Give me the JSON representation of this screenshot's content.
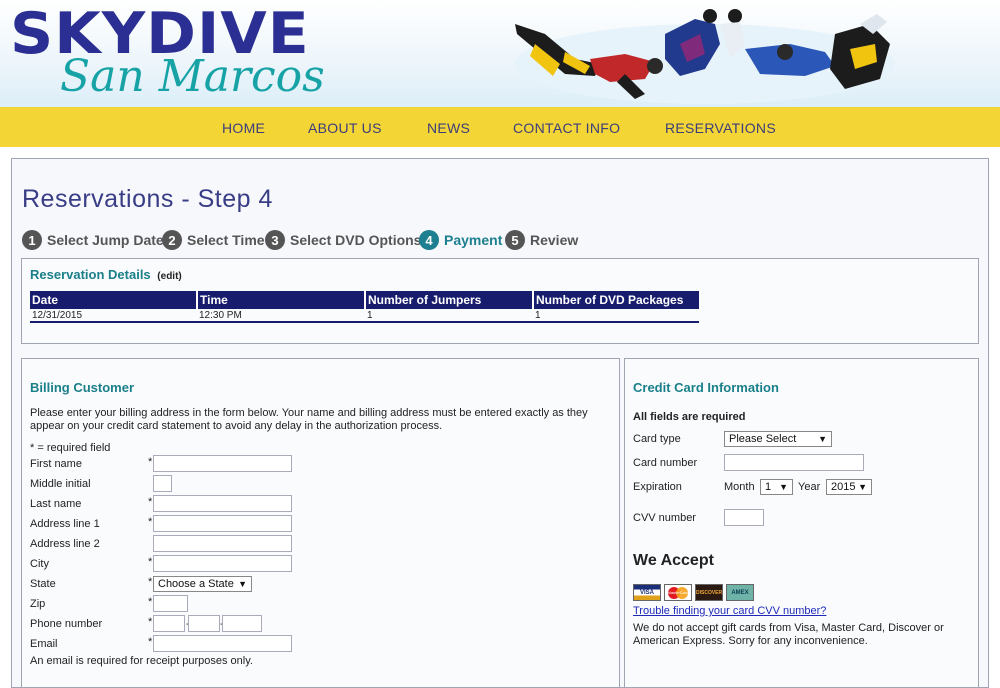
{
  "header": {
    "logo_top": "SKYDIVE",
    "logo_bottom": "San Marcos"
  },
  "nav": {
    "items": [
      "HOME",
      "ABOUT US",
      "NEWS",
      "CONTACT INFO",
      "RESERVATIONS"
    ]
  },
  "page": {
    "title": "Reservations - Step 4"
  },
  "steps": [
    {
      "num": "1",
      "label": "Select Jump Date"
    },
    {
      "num": "2",
      "label": "Select Time"
    },
    {
      "num": "3",
      "label": "Select DVD Options"
    },
    {
      "num": "4",
      "label": "Payment"
    },
    {
      "num": "5",
      "label": "Review"
    }
  ],
  "reservation": {
    "title": "Reservation Details",
    "edit": "(edit)",
    "headers": [
      "Date",
      "Time",
      "Number of Jumpers",
      "Number of DVD Packages"
    ],
    "row": [
      "12/31/2015",
      "12:30 PM",
      "1",
      "1"
    ]
  },
  "billing": {
    "title": "Billing Customer",
    "intro": "Please enter your billing address in the form below. Your name and billing address must be entered exactly as they appear on your credit card statement to avoid any delay in the authorization process.",
    "required_note": "* = required field",
    "fields": {
      "first_name": "First name",
      "middle_initial": "Middle initial",
      "last_name": "Last name",
      "address1": "Address line 1",
      "address2": "Address line 2",
      "city": "City",
      "state": "State",
      "zip": "Zip",
      "phone": "Phone number",
      "email": "Email"
    },
    "state_select": "Choose a State",
    "email_note": "An email is required for receipt purposes only."
  },
  "credit": {
    "title": "Credit Card Information",
    "all_required": "All fields are required",
    "card_type_label": "Card type",
    "card_type_value": "Please Select",
    "card_number_label": "Card number",
    "expiration_label": "Expiration",
    "month_label": "Month",
    "month_value": "1",
    "year_label": "Year",
    "year_value": "2015",
    "cvv_label": "CVV number",
    "we_accept": "We Accept",
    "cvv_link": "Trouble finding your card CVV number?",
    "note": "We do not accept gift cards from Visa, Master Card, Discover or American Express. Sorry for any inconvenience.",
    "cards": {
      "visa": "VISA",
      "mastercard": "MasterCard",
      "discover": "DISCOVER",
      "amex": "AMEX"
    }
  },
  "colors": {
    "nav_bg": "#f3d535",
    "accent": "#1d7f8f",
    "brand": "#2b2f93",
    "table_header": "#171c6c"
  }
}
